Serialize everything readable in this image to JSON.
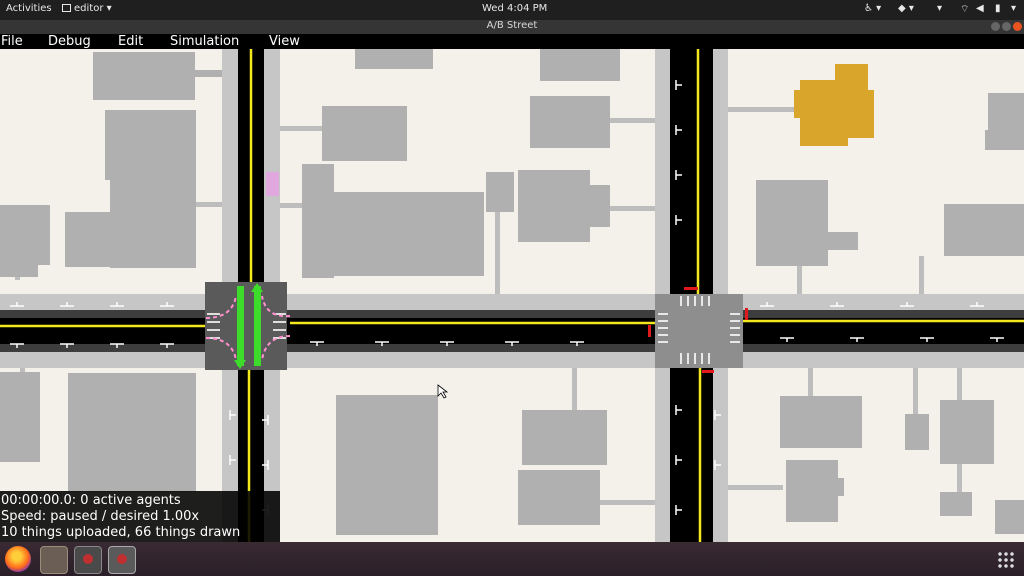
{
  "top_bar": {
    "activities": "Activities",
    "app_menu": "editor",
    "clock": "Wed  4:04 PM"
  },
  "window": {
    "title": "A/B Street"
  },
  "menu": {
    "file": "File",
    "debug": "Debug",
    "edit": "Edit",
    "simulation": "Simulation",
    "view": "View"
  },
  "status": {
    "line1": "00:00:00.0: 0 active agents",
    "line2": "Speed: paused / desired 1.00x",
    "line3": "10 things uploaded, 66 things drawn"
  },
  "colors": {
    "building": "#b0b0b0",
    "selected_building": "#d9a52a",
    "road": "#000000",
    "center_line": "#f2e81d",
    "green_signal": "#3ddc2b",
    "red_signal": "#e0191c",
    "crosswalk": "#ff8fcf"
  },
  "dock": {
    "icons": [
      "firefox-icon",
      "files-icon",
      "terminal-icon",
      "terminal-icon",
      "apps-grid-icon"
    ]
  }
}
